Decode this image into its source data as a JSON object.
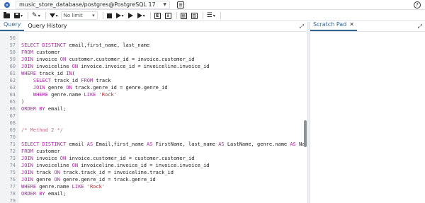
{
  "connection": {
    "label": "music_store_database/postgres@PostgreSQL 17"
  },
  "toolbar": {
    "limit_label": "No limit"
  },
  "tabs": {
    "query": "Query",
    "history": "Query History",
    "scratch": "Scratch Pad"
  },
  "icons": {
    "db": "database-icon",
    "help": "help-icon",
    "open": "folder-icon",
    "save": "save-icon",
    "edit": "pen-icon",
    "filter": "filter-icon",
    "stop": "stop-icon",
    "run": "play-icon",
    "explain": "explain-icon",
    "commit": "commit-icon",
    "rollback": "rollback-icon",
    "macros": "list-icon",
    "close": "close-icon"
  },
  "colors": {
    "accent": "#326690",
    "keyword": "#a626a4",
    "string": "#a33333",
    "comment": "#c06c84"
  },
  "editor": {
    "lines": [
      {
        "n": "56",
        "t": ""
      },
      {
        "n": "57",
        "t": "SELECT DISTINCT email,first_name, last_name"
      },
      {
        "n": "58",
        "t": "FROM customer"
      },
      {
        "n": "59",
        "t": "JOIN invoice ON customer.customer_id = invoice.customer_id"
      },
      {
        "n": "60",
        "t": "JOIN invoiceline ON invoice.invoice_id = invoiceline.invoice_id"
      },
      {
        "n": "61",
        "t": "WHERE track_id IN("
      },
      {
        "n": "62",
        "t": "    SELECT track_id FROM track"
      },
      {
        "n": "63",
        "t": "    JOIN genre ON track.genre_id = genre.genre_id"
      },
      {
        "n": "64",
        "t": "    WHERE genre.name LIKE 'Rock'"
      },
      {
        "n": "65",
        "t": ")"
      },
      {
        "n": "66",
        "t": "ORDER BY email;"
      },
      {
        "n": "67",
        "t": ""
      },
      {
        "n": "68",
        "t": ""
      },
      {
        "n": "69",
        "t": "/* Method 2 */"
      },
      {
        "n": "70",
        "t": ""
      },
      {
        "n": "71",
        "t": "SELECT DISTINCT email AS Email,first_name AS FirstName, last_name AS LastName, genre.name AS Nam"
      },
      {
        "n": "72",
        "t": "FROM customer"
      },
      {
        "n": "73",
        "t": "JOIN invoice ON invoice.customer_id = customer.customer_id"
      },
      {
        "n": "74",
        "t": "JOIN invoiceline ON invoiceline.invoice_id = invoice.invoice_id"
      },
      {
        "n": "75",
        "t": "JOIN track ON track.track_id = invoiceline.track_id"
      },
      {
        "n": "76",
        "t": "JOIN genre ON genre.genre_id = track.genre_id"
      },
      {
        "n": "77",
        "t": "WHERE genre.name LIKE 'Rock'"
      },
      {
        "n": "78",
        "t": "ORDER BY email;"
      },
      {
        "n": "79",
        "t": ""
      }
    ]
  }
}
